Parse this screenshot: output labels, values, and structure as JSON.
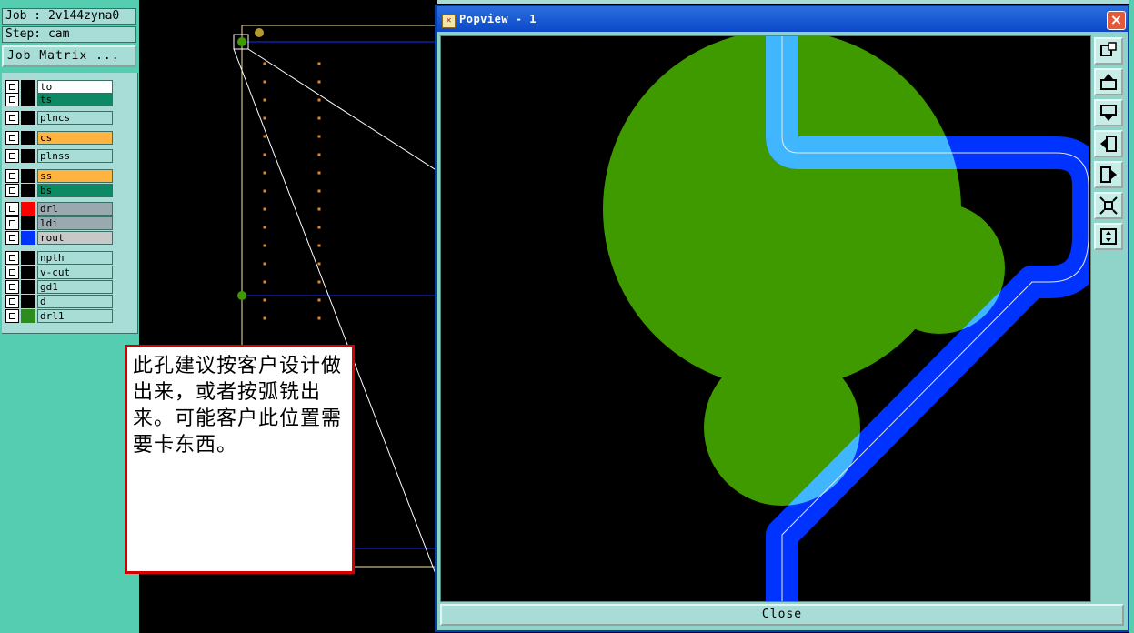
{
  "job_info": {
    "job_line": "Job : 2v144zyna0",
    "step_line": "Step: cam"
  },
  "job_matrix_button": "Job Matrix ...",
  "layers": [
    {
      "label": "to",
      "color": "#ffffff",
      "swatch": "#000000"
    },
    {
      "label": "ts",
      "color": "#0d8a63",
      "swatch": "#000000"
    },
    {
      "label": "plncs",
      "color": "#a8dcd6",
      "swatch": "#000000"
    },
    {
      "label": "cs",
      "color": "#ffb340",
      "swatch": "#000000"
    },
    {
      "label": "plnss",
      "color": "#a8dcd6",
      "swatch": "#000000"
    },
    {
      "label": "ss",
      "color": "#ffb340",
      "swatch": "#000000"
    },
    {
      "label": "bs",
      "color": "#0d8a63",
      "swatch": "#000000"
    },
    {
      "label": "drl",
      "color": "#9aa8b0",
      "swatch": "#ff0000"
    },
    {
      "label": "ldi",
      "color": "#9aa8b0",
      "swatch": "#000000"
    },
    {
      "label": "rout",
      "color": "#c8c8c8",
      "swatch": "#0033ff"
    },
    {
      "label": "npth",
      "color": "#a8dcd6",
      "swatch": "#000000"
    },
    {
      "label": "v-cut",
      "color": "#a8dcd6",
      "swatch": "#000000"
    },
    {
      "label": "gd1",
      "color": "#a8dcd6",
      "swatch": "#000000"
    },
    {
      "label": "d",
      "color": "#a8dcd6",
      "swatch": "#000000"
    },
    {
      "label": "drl1",
      "color": "#a8dcd6",
      "swatch": "#2e8b1e"
    }
  ],
  "annotation": {
    "text": "此孔建议按客户设计做出来，或者按弧铣出来。可能客户此位置需要卡东西。"
  },
  "popview": {
    "title": "Popview - 1",
    "close_button": "Close",
    "toolbar_icons": [
      "zoom-fit-icon",
      "pan-up-icon",
      "pan-down-icon",
      "pan-left-icon",
      "pan-right-icon",
      "zoom-in-icon",
      "zoom-out-icon"
    ]
  },
  "colors": {
    "panel_bg": "#55cdb0",
    "copper_green": "#3f9a00",
    "rout_blue": "#0033ff",
    "overlap_cyan": "#40b6ff",
    "annotation_border": "#d40000"
  }
}
